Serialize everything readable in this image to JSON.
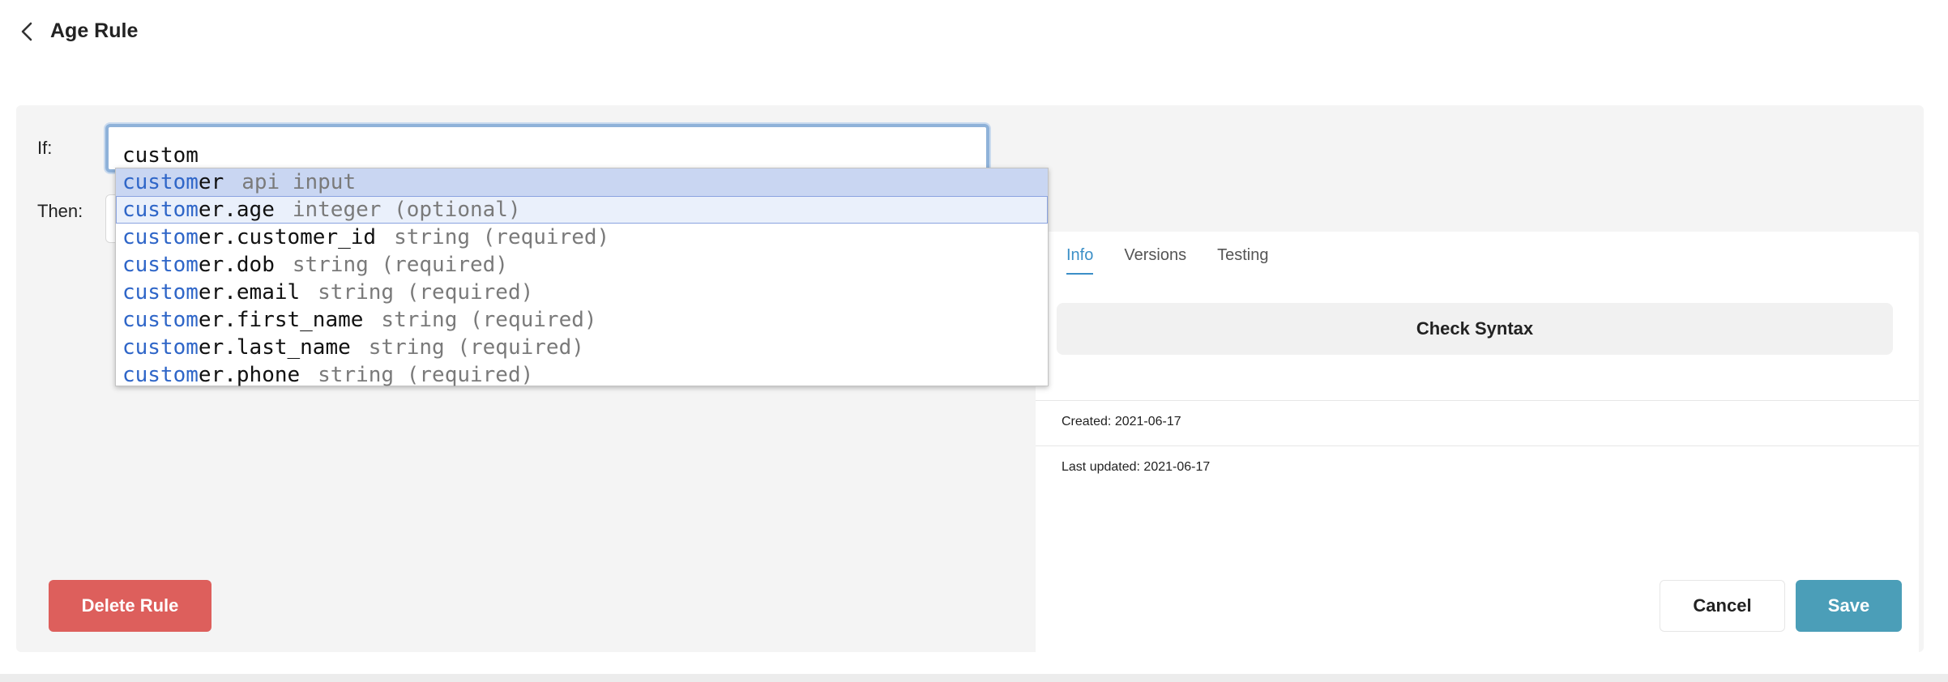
{
  "header": {
    "title": "Age Rule",
    "back_icon": "chevron-left-icon"
  },
  "editor": {
    "if_label": "If:",
    "then_label": "Then:",
    "if_value": "custom",
    "then_value": ""
  },
  "autocomplete": {
    "items": [
      {
        "match": "custom",
        "rest": "er",
        "meta": "api input"
      },
      {
        "match": "custom",
        "rest": "er.age",
        "meta": "integer (optional)"
      },
      {
        "match": "custom",
        "rest": "er.customer_id",
        "meta": "string (required)"
      },
      {
        "match": "custom",
        "rest": "er.dob",
        "meta": "string (required)"
      },
      {
        "match": "custom",
        "rest": "er.email",
        "meta": "string (required)"
      },
      {
        "match": "custom",
        "rest": "er.first_name",
        "meta": "string (required)"
      },
      {
        "match": "custom",
        "rest": "er.last_name",
        "meta": "string (required)"
      },
      {
        "match": "custom",
        "rest": "er.phone",
        "meta": "string (required)"
      }
    ]
  },
  "side": {
    "tabs": [
      {
        "label": "Info"
      },
      {
        "label": "Versions"
      },
      {
        "label": "Testing"
      }
    ],
    "check_syntax_label": "Check Syntax",
    "created_label": "Created:",
    "created_value": "2021-06-17",
    "updated_label": "Last updated:",
    "updated_value": "2021-06-17"
  },
  "actions": {
    "delete_label": "Delete Rule",
    "cancel_label": "Cancel",
    "save_label": "Save"
  },
  "colors": {
    "accent": "#3b8fc7",
    "delete": "#dd5f5c",
    "save": "#4b9eb8",
    "match": "#2f66c8"
  }
}
